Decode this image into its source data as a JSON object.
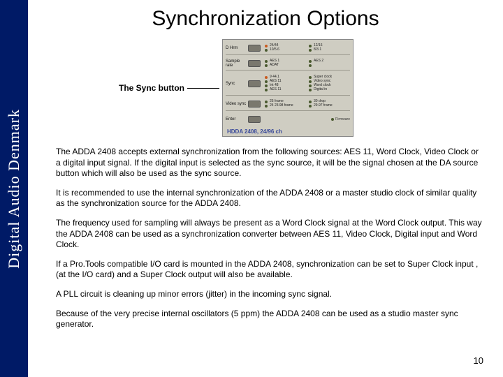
{
  "sidebar": "Digital Audio Denmark",
  "title": "Synchronization Options",
  "figure": {
    "caption": "The Sync button",
    "panel": {
      "rows": [
        {
          "label": "D Hrm",
          "leds": [
            "24/44",
            "12/16",
            "10/5.6",
            "8/3.1"
          ]
        },
        {
          "label": "Sample rate",
          "leds": [
            "AES 1",
            "AES 2",
            "ADAT",
            ""
          ]
        },
        {
          "label": "Sync",
          "leds": [
            "9 44.1",
            "AES 11",
            "Int 48",
            "AES 11",
            "Super clock",
            "Video sync",
            "Word clock",
            "Digital in"
          ]
        },
        {
          "label": "Video sync",
          "leds": [
            "25 frame",
            "24 23.98 frame",
            "30 drop",
            "29.97 frame"
          ]
        },
        {
          "label": "Enter",
          "leds": []
        }
      ],
      "firmware_label": "Firmware",
      "footer": "HDDA 2408, 24/96 ch"
    }
  },
  "paragraphs": [
    "The ADDA 2408 accepts external synchronization from the following sources: AES 11, Word Clock, Video Clock or a digital input signal. If the digital input is selected as the sync source, it will be the signal chosen at the DA source button which will also be used as the sync source.",
    "It is recommended to use the internal synchronization of the ADDA 2408 or a master studio clock of similar quality as the synchronization source for the ADDA 2408.",
    "The frequency used for sampling will always be present as a Word Clock signal at the Word Clock output. This way the ADDA 2408 can be used as a synchronization converter between AES 11, Video Clock,  Digital input and Word Clock.",
    "If a Pro.Tools compatible I/O card is mounted in the ADDA 2408, synchronization can be set to Super Clock input , (at the I/O card) and a Super Clock  output  will also be available.",
    "A PLL circuit is cleaning up minor errors (jitter) in the incoming sync signal.",
    "Because of the very precise internal oscillators (5 ppm) the ADDA 2408 can be used as a studio master sync generator."
  ],
  "page_number": "10"
}
